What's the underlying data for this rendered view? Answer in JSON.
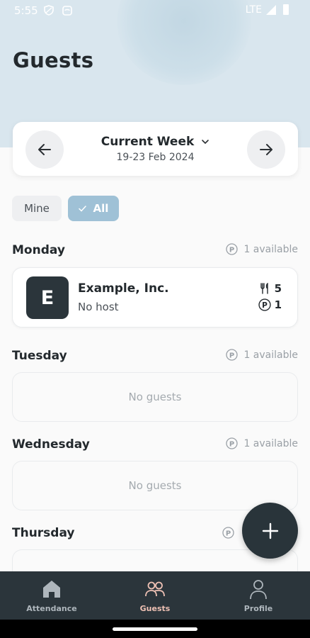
{
  "status_bar": {
    "time": "5:55",
    "network": "LTE"
  },
  "header": {
    "title": "Guests"
  },
  "week_selector": {
    "title": "Current Week",
    "range": "19-23 Feb 2024"
  },
  "filters": {
    "mine": "Mine",
    "all": "All",
    "selected": "All"
  },
  "days": [
    {
      "name": "Monday",
      "availability": "1 available",
      "guests": [
        {
          "initial": "E",
          "company": "Example, Inc.",
          "host": "No host",
          "meals": "5",
          "parking": "1"
        }
      ]
    },
    {
      "name": "Tuesday",
      "availability": "1 available",
      "empty_text": "No guests"
    },
    {
      "name": "Wednesday",
      "availability": "1 available",
      "empty_text": "No guests"
    },
    {
      "name": "Thursday"
    }
  ],
  "bottom_nav": {
    "items": [
      {
        "label": "Attendance",
        "icon": "home-icon"
      },
      {
        "label": "Guests",
        "icon": "people-icon",
        "active": true
      },
      {
        "label": "Profile",
        "icon": "person-icon"
      }
    ]
  },
  "colors": {
    "accent": "#9fc1d6",
    "dark": "#2b353b",
    "active_nav": "#eec1b4"
  }
}
